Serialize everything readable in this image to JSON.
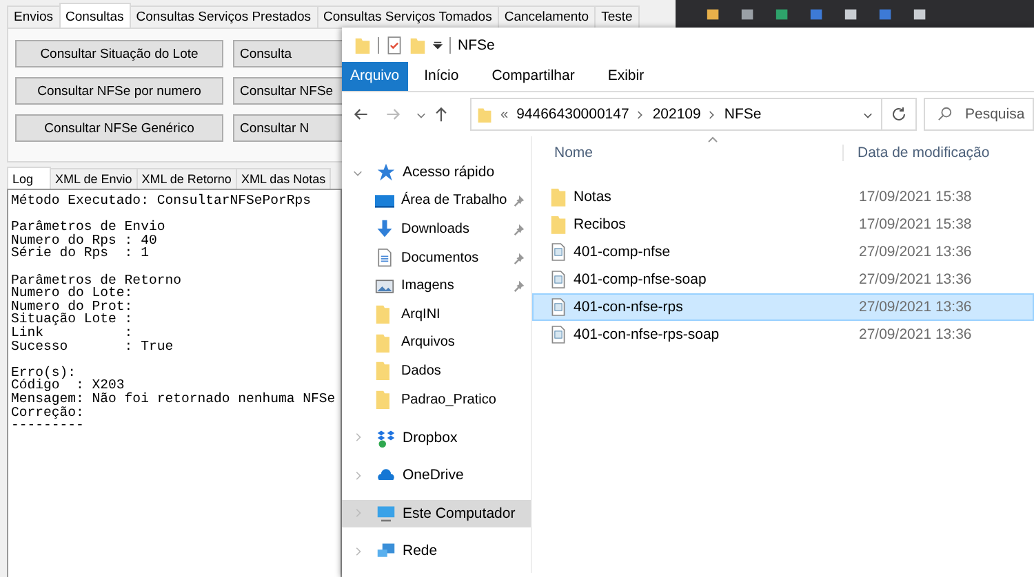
{
  "app": {
    "tabs": [
      {
        "label": "Envios",
        "selected": false
      },
      {
        "label": "Consultas",
        "selected": true
      },
      {
        "label": "Consultas Serviços Prestados",
        "selected": false
      },
      {
        "label": "Consultas Serviços Tomados",
        "selected": false
      },
      {
        "label": "Cancelamento",
        "selected": false
      },
      {
        "label": "Teste",
        "selected": false
      }
    ],
    "buttons": [
      [
        "Consultar Situação do Lote",
        "Consulta"
      ],
      [
        "Consultar NFSe por numero",
        "Consultar NFSe"
      ],
      [
        "Consultar NFSe Genérico",
        "Consultar N"
      ]
    ],
    "log_tabs": [
      {
        "label": "Log",
        "selected": true
      },
      {
        "label": "XML de Envio",
        "selected": false
      },
      {
        "label": "XML de Retorno",
        "selected": false
      },
      {
        "label": "XML das Notas",
        "selected": false
      }
    ],
    "log_blocks": [
      [
        "Método Executado: ConsultarNFSePorRps"
      ],
      [
        "Parâmetros de Envio",
        "Numero do Rps : 40",
        "Série do Rps  : 1"
      ],
      [
        "Parâmetros de Retorno",
        "Numero do Lote:",
        "Numero do Prot:",
        "Situação Lote :",
        "Link          :",
        "Sucesso       : True"
      ],
      [
        "Erro(s):",
        "Código  : X203",
        "Mensagem: Não foi retornado nenhuma NFSe",
        "Correção:",
        "---------"
      ]
    ]
  },
  "explorer": {
    "title": "NFSe",
    "ribbon_tabs": [
      {
        "label": "Arquivo",
        "selected": true
      },
      {
        "label": "Início",
        "selected": false
      },
      {
        "label": "Compartilhar",
        "selected": false
      },
      {
        "label": "Exibir",
        "selected": false
      }
    ],
    "address": {
      "overflow": "«",
      "path": [
        "94466430000147",
        "202109",
        "NFSe"
      ]
    },
    "search": {
      "placeholder": "Pesquisa"
    },
    "nav": [
      {
        "label": "Acesso rápido",
        "kind": "star",
        "expanded": true,
        "selected": false,
        "children": [
          {
            "label": "Área de Trabalho",
            "kind": "desktop",
            "pinned": true,
            "selected": false
          },
          {
            "label": "Downloads",
            "kind": "download",
            "pinned": true,
            "selected": false
          },
          {
            "label": "Documentos",
            "kind": "document",
            "pinned": true,
            "selected": false
          },
          {
            "label": "Imagens",
            "kind": "image",
            "pinned": true,
            "selected": false
          },
          {
            "label": "ArqINI",
            "kind": "folder",
            "pinned": false,
            "selected": false
          },
          {
            "label": "Arquivos",
            "kind": "folder",
            "pinned": false,
            "selected": false
          },
          {
            "label": "Dados",
            "kind": "folder",
            "pinned": false,
            "selected": false
          },
          {
            "label": "Padrao_Pratico",
            "kind": "folder",
            "pinned": false,
            "selected": false
          }
        ]
      },
      {
        "label": "Dropbox",
        "kind": "dropbox",
        "expanded": false,
        "selected": false
      },
      {
        "label": "OneDrive",
        "kind": "cloud",
        "expanded": false,
        "selected": false
      },
      {
        "label": "Este Computador",
        "kind": "computer",
        "expanded": false,
        "selected": true
      },
      {
        "label": "Rede",
        "kind": "network",
        "expanded": false,
        "selected": false
      }
    ],
    "columns": [
      "Nome",
      "Data de modificação"
    ],
    "files": [
      {
        "name": "Notas",
        "kind": "folder",
        "modified": "17/09/2021 15:38",
        "selected": false
      },
      {
        "name": "Recibos",
        "kind": "folder",
        "modified": "17/09/2021 15:38",
        "selected": false
      },
      {
        "name": "401-comp-nfse",
        "kind": "file",
        "modified": "27/09/2021 13:36",
        "selected": false
      },
      {
        "name": "401-comp-nfse-soap",
        "kind": "file",
        "modified": "27/09/2021 13:36",
        "selected": false
      },
      {
        "name": "401-con-nfse-rps",
        "kind": "file",
        "modified": "27/09/2021 13:36",
        "selected": true
      },
      {
        "name": "401-con-nfse-rps-soap",
        "kind": "file",
        "modified": "27/09/2021 13:36",
        "selected": false
      }
    ]
  }
}
